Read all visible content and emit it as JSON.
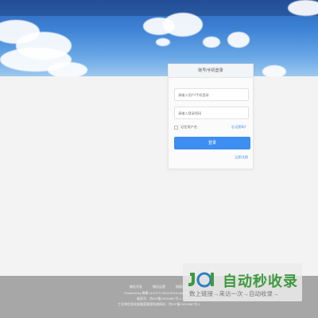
{
  "login": {
    "title": "账号/手机登录",
    "username_placeholder": "请输入用户/手机登录",
    "password_placeholder": "请输入登录密码",
    "remember_label": "记住用户名",
    "forgot_label": "忘记密码？",
    "submit_label": "登录",
    "register_label": "立即注册"
  },
  "footer": {
    "links": [
      "微信开发",
      "微信运营",
      "微微论坛"
    ],
    "powered": "Powered by 微擎 v2.0.5 © 2014-2019 www.w7.cc",
    "icp1": "备案号：京ICP备19019887号-1",
    "icp2": "工业和信息化部备案管理系统网站：京ICP备19019887号-1"
  },
  "watermark": {
    "title": "自动秒收录",
    "subtitle": "数上链接→来访一次→自动收录→"
  },
  "colors": {
    "accent": "#3d8ef0",
    "link": "#3c8de0",
    "footer_bg": "#a7a7a7",
    "watermark_green": "#3e9a3e"
  }
}
